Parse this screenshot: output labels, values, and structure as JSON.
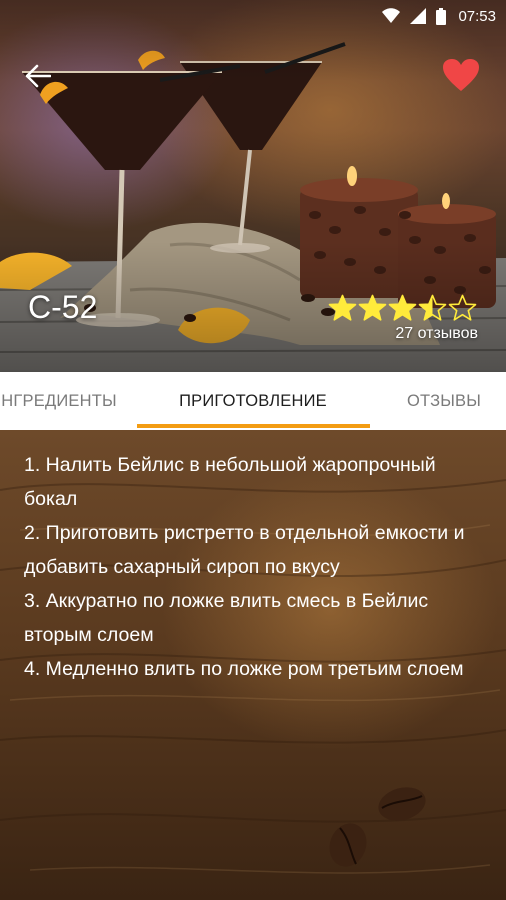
{
  "status_bar": {
    "time": "07:53"
  },
  "header": {
    "back_icon": "arrow-left-icon",
    "favorite_icon": "heart-icon",
    "favorite_color": "#f04646"
  },
  "cocktail": {
    "name": "С-52",
    "rating": 3.5,
    "rating_max": 5,
    "reviews_label": "27 отзывов",
    "star_color": "#ffeb3b"
  },
  "tabs": {
    "items": [
      {
        "label": "ИНГРЕДИЕНТЫ"
      },
      {
        "label": "ПРИГОТОВЛЕНИЕ"
      },
      {
        "label": "ОТЗЫВЫ"
      }
    ],
    "active_index": 1,
    "accent_color": "#f39c12"
  },
  "preparation": {
    "steps": [
      "1. Налить Бейлис в небольшой жаропрочный бокал",
      "2. Приготовить ристретто в отдельной емкости и добавить сахарный сироп по вкусу",
      "3. Аккуратно по ложке влить смесь в Бейлис вторым слоем",
      "4. Медленно влить по ложке ром третьим слоем"
    ]
  }
}
